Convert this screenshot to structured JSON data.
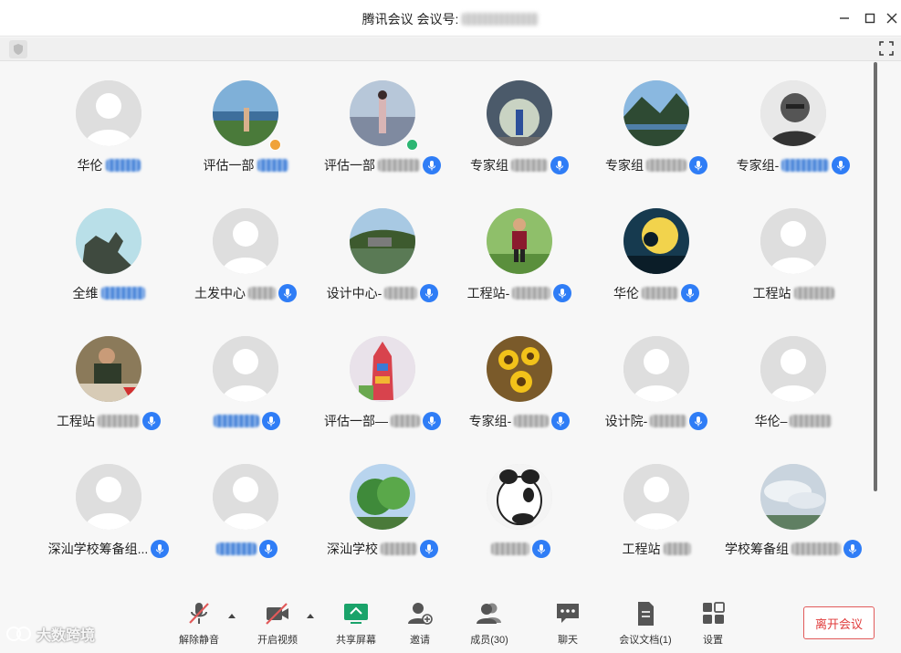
{
  "window": {
    "title": "腾讯会议 会议号:",
    "controls": [
      "minimize-icon",
      "maximize-icon",
      "close-icon"
    ]
  },
  "participants": [
    {
      "name": "华伦",
      "avatar": "default",
      "mic": false,
      "redacted": true
    },
    {
      "name": "评估一部",
      "avatar": "photo-lake",
      "mic": false,
      "redacted": true,
      "badge": "#f0a23a"
    },
    {
      "name": "评估一部",
      "avatar": "photo-girl",
      "mic": true,
      "redacted": true,
      "badge": "#2db673"
    },
    {
      "name": "专家组",
      "avatar": "photo-tunnel",
      "mic": true,
      "redacted": true
    },
    {
      "name": "专家组",
      "avatar": "photo-mountain",
      "mic": true,
      "redacted": true
    },
    {
      "name": "专家组-",
      "avatar": "photo-man-bw",
      "mic": true,
      "redacted": true
    },
    {
      "name": "全维",
      "avatar": "photo-dragon",
      "mic": false,
      "redacted": true
    },
    {
      "name": "土发中心",
      "avatar": "default",
      "mic": true,
      "redacted": true
    },
    {
      "name": "设计中心-",
      "avatar": "photo-river",
      "mic": true,
      "redacted": true
    },
    {
      "name": "工程站-",
      "avatar": "photo-child",
      "mic": true,
      "redacted": true
    },
    {
      "name": "华伦",
      "avatar": "photo-moon",
      "mic": true,
      "redacted": true
    },
    {
      "name": "工程站",
      "avatar": "default",
      "mic": false,
      "redacted": true
    },
    {
      "name": "工程站",
      "avatar": "photo-dinner",
      "mic": true,
      "redacted": true
    },
    {
      "name": "",
      "avatar": "default",
      "mic": true,
      "redacted": true
    },
    {
      "name": "评估一部—",
      "avatar": "photo-drawing",
      "mic": true,
      "redacted": true
    },
    {
      "name": "专家组-",
      "avatar": "photo-sunflower",
      "mic": true,
      "redacted": true
    },
    {
      "name": "设计院-",
      "avatar": "default",
      "mic": true,
      "redacted": true
    },
    {
      "name": "华伦–",
      "avatar": "default",
      "mic": false,
      "redacted": true
    },
    {
      "name": "深汕学校筹备组...",
      "avatar": "default",
      "mic": true,
      "redacted": false
    },
    {
      "name": "",
      "avatar": "default",
      "mic": true,
      "redacted": true
    },
    {
      "name": "深汕学校",
      "avatar": "photo-tree",
      "mic": true,
      "redacted": true
    },
    {
      "name": "",
      "avatar": "photo-panda",
      "mic": true,
      "redacted": true
    },
    {
      "name": "工程站",
      "avatar": "default",
      "mic": false,
      "redacted": true
    },
    {
      "name": "学校筹备组",
      "avatar": "photo-sky",
      "mic": true,
      "redacted": true
    }
  ],
  "toolbar": {
    "unmute": "解除静音",
    "start_video": "开启视频",
    "share_screen": "共享屏幕",
    "invite": "邀请",
    "members": "成员(30)",
    "chat": "聊天",
    "docs": "会议文档(1)",
    "settings": "设置",
    "leave": "离开会议"
  },
  "watermark": "大数跨境",
  "colors": {
    "accent_blue": "#2f7df6",
    "share_green": "#1aa36a",
    "leave_red": "#e03b3b",
    "muted_red": "#e15a5a"
  }
}
